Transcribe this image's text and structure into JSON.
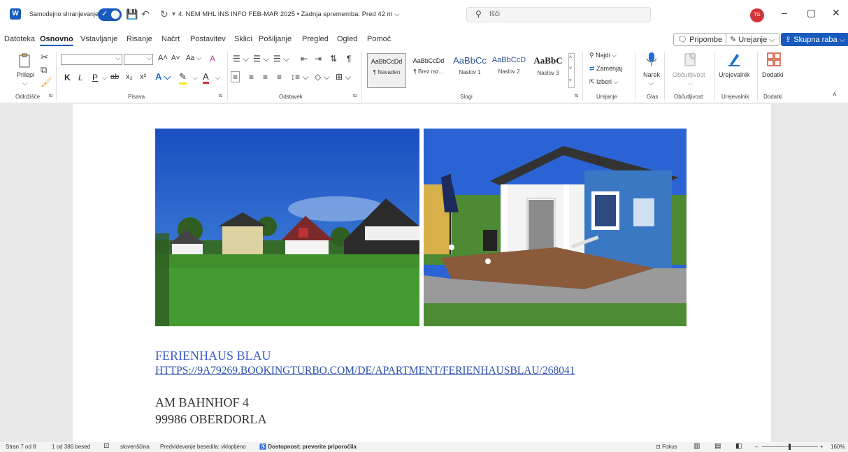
{
  "titlebar": {
    "logo": "W",
    "autosave_label": "Samodejno shranjevanje",
    "doc_title": "4. NEM MHL INS INFO FEB-MAR 2025 • Zadnja sprememba: Pred 42 m ⌵",
    "search_placeholder": "Išči",
    "avatar_initials": "TG",
    "minimize": "–",
    "restore": "▢",
    "close": "✕"
  },
  "menu": {
    "items": [
      "Datoteka",
      "Osnovno",
      "Vstavljanje",
      "Risanje",
      "Načrt",
      "Postavitev",
      "Sklici",
      "Pošiljanje",
      "Pregled",
      "Ogled",
      "Pomoč"
    ],
    "comments_btn": "Pripombe",
    "editing_btn": "Urejanje ⌵",
    "share_btn": "Skupna raba ⌵"
  },
  "ribbon": {
    "paste_label": "Prilepi",
    "group_clipboard": "Odložišče",
    "group_font": "Pisava",
    "group_paragraph": "Odstavek",
    "group_styles": "Slogi",
    "group_editing": "Urejanje",
    "group_voice": "Glas",
    "group_sensitivity": "Občutljivost",
    "group_editor": "Urejevalnik",
    "group_addins": "Dodatki",
    "font_bold": "K",
    "font_italic": "L",
    "font_underline": "P",
    "styles": [
      {
        "sample": "AaBbCcDd",
        "name": "¶ Navaden"
      },
      {
        "sample": "AaBbCcDd",
        "name": "¶ Brez raz..."
      },
      {
        "sample": "AaBbCc",
        "name": "Naslov 1"
      },
      {
        "sample": "AaBbCcD",
        "name": "Naslov 2"
      },
      {
        "sample": "AaBbC",
        "name": "Naslov 3"
      }
    ],
    "find": "Najdi ⌵",
    "replace": "Zamenjaj",
    "select": "Izberi ⌵",
    "dictate": "Narek",
    "sensitivity": "Občutljivost",
    "editor": "Urejevalnik",
    "addins": "Dodatki"
  },
  "document": {
    "heading": "FERIENHAUS BLAU",
    "link": "HTTPS://9A79269.BOOKINGTURBO.COM/DE/APARTMENT/FERIENHAUSBLAU/268041",
    "address_line1": "AM BAHNHOF 4",
    "address_line2": "99986 OBERDORLA"
  },
  "status": {
    "page": "Stran 7 od 8",
    "words": "1 od 386 besed",
    "language": "slovenščina",
    "prediction": "Predvidevanje besedila: vklopljeno",
    "accessibility": "Dostopnost: preverite priporočila",
    "focus": "Fokus",
    "zoom": "160%"
  }
}
